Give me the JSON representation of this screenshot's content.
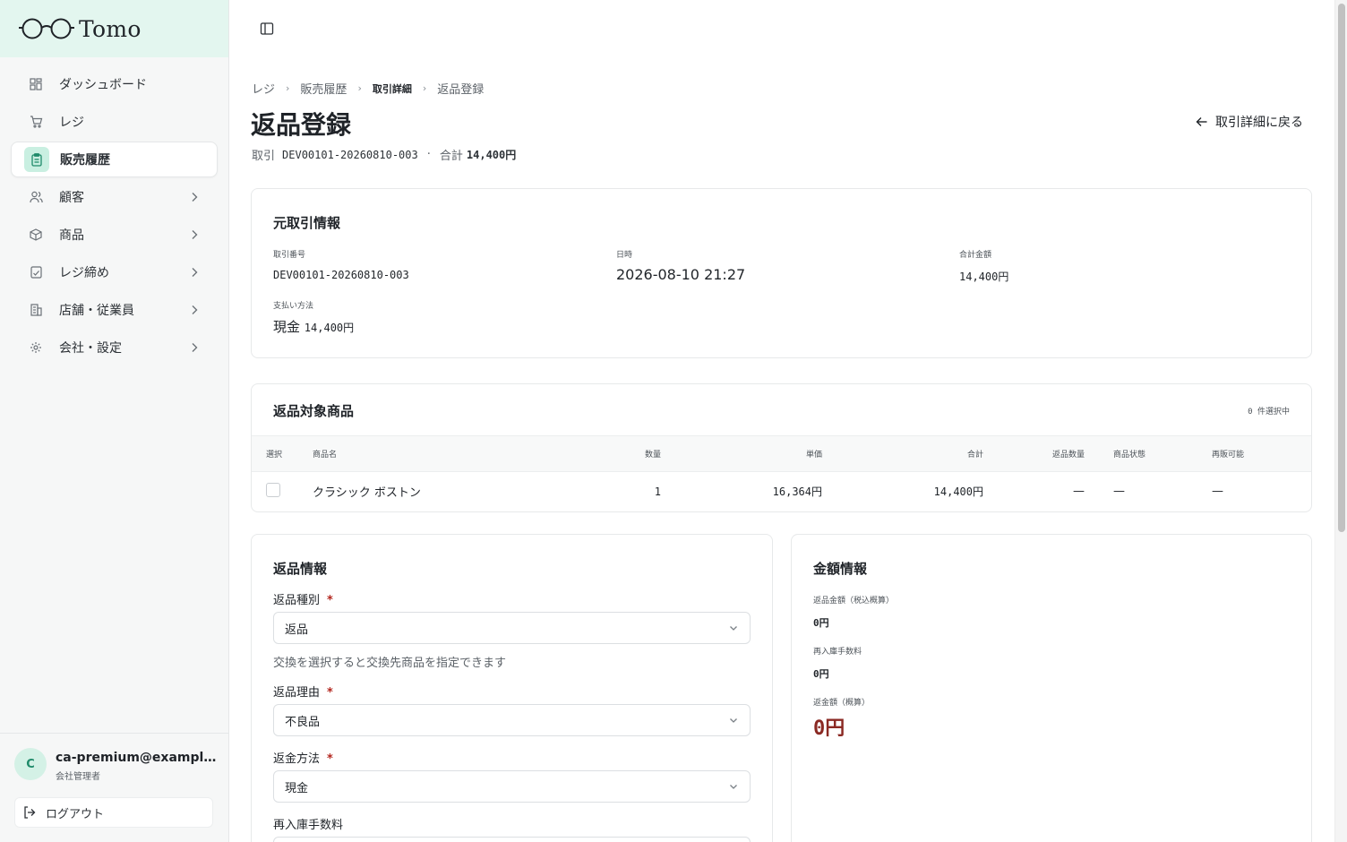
{
  "app": {
    "name": "Tomo"
  },
  "sidebar": {
    "items": [
      {
        "label": "ダッシュボード",
        "icon": "dashboard-icon"
      },
      {
        "label": "レジ",
        "icon": "cart-icon"
      },
      {
        "label": "販売履歴",
        "icon": "clipboard-icon",
        "active": true
      },
      {
        "label": "顧客",
        "icon": "users-icon",
        "expandable": true
      },
      {
        "label": "商品",
        "icon": "box-icon",
        "expandable": true
      },
      {
        "label": "レジ締め",
        "icon": "checklist-icon",
        "expandable": true
      },
      {
        "label": "店舗・従業員",
        "icon": "building-icon",
        "expandable": true
      },
      {
        "label": "会社・設定",
        "icon": "gear-icon",
        "expandable": true
      }
    ]
  },
  "user": {
    "initial": "C",
    "email": "ca-premium@example.com",
    "role": "会社管理者",
    "logout_label": "ログアウト"
  },
  "breadcrumb": [
    "レジ",
    "販売履歴",
    "取引詳細",
    "返品登録"
  ],
  "page": {
    "title": "返品登録",
    "back_label": "取引詳細に戻る",
    "sub_prefix": "取引",
    "transaction_id": "DEV00101-20260810-003",
    "total_label": "合計",
    "total_value": "14,400円"
  },
  "original": {
    "title": "元取引情報",
    "txn_no_label": "取引番号",
    "txn_no": "DEV00101-20260810-003",
    "datetime_label": "日時",
    "datetime": "2026-08-10 21:27",
    "amount_label": "合計金額",
    "amount": "14,400円",
    "payment_label": "支払い方法",
    "payment_method": "現金",
    "payment_amount": "14,400円"
  },
  "items": {
    "title": "返品対象商品",
    "selected_count": "0 件選択中",
    "columns": [
      "選択",
      "商品名",
      "数量",
      "単価",
      "合計",
      "返品数量",
      "商品状態",
      "再販可能"
    ],
    "rows": [
      {
        "name": "クラシック ボストン",
        "qty": "1",
        "unit_price": "16,364円",
        "total": "14,400円",
        "return_qty": "—",
        "condition": "—",
        "resellable": "—"
      }
    ]
  },
  "return_info": {
    "title": "返品情報",
    "type_label": "返品種別",
    "type_value": "返品",
    "type_hint": "交換を選択すると交換先商品を指定できます",
    "reason_label": "返品理由",
    "reason_value": "不良品",
    "refund_method_label": "返金方法",
    "refund_method_value": "現金",
    "restock_fee_label": "再入庫手数料",
    "required_mark": "*"
  },
  "amount_info": {
    "title": "金額情報",
    "return_amount_label": "返品金額（税込概算）",
    "return_amount": "0円",
    "restock_fee_label": "再入庫手数料",
    "restock_fee": "0円",
    "refund_label": "返金額（概算）",
    "refund": "0円"
  },
  "colors": {
    "accent": "#1f8a6a",
    "logo_bg": "#e3f6ef",
    "refund": "#8b2a24",
    "required": "#b3261e"
  }
}
